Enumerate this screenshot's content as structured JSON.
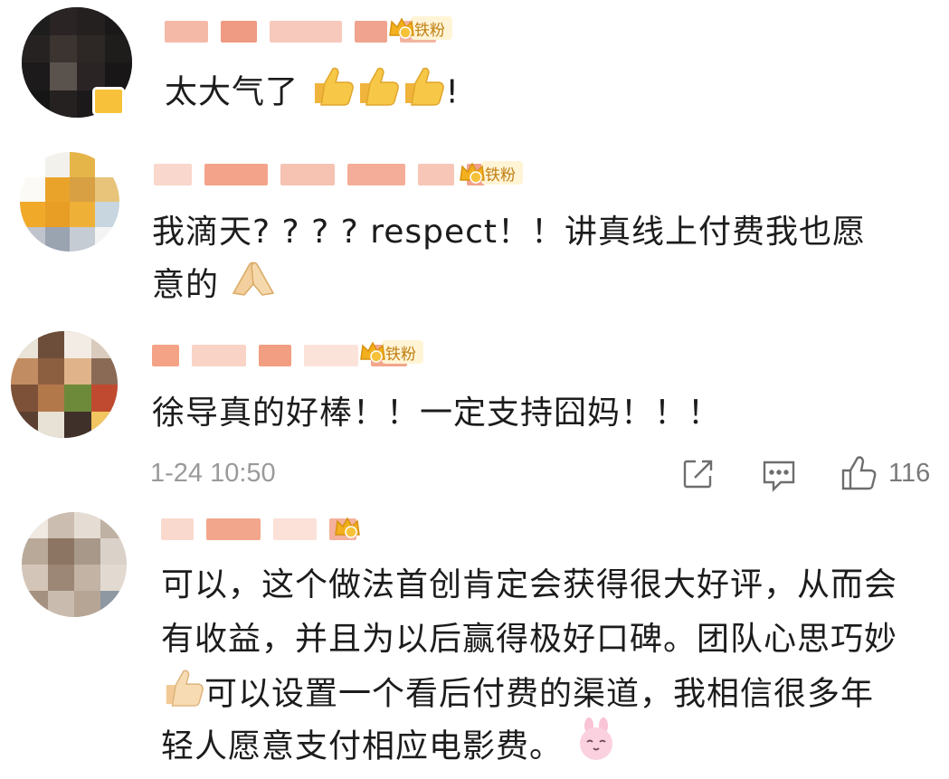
{
  "comments": [
    {
      "name_hidden": true,
      "fan_level": "4",
      "fan_label": "铁粉",
      "text": "太大气了",
      "text_suffix": "!",
      "emoji": [
        "thumbs-up",
        "thumbs-up",
        "thumbs-up"
      ]
    },
    {
      "name_hidden": true,
      "fan_level": "6",
      "fan_label": "铁粉",
      "line1": "我滴天? ? ? ? respect！！讲真线上付费我也愿",
      "line2": "意的",
      "emoji": [
        "pray"
      ]
    },
    {
      "name_hidden": true,
      "fan_level": "4",
      "fan_label": "铁粉",
      "text": "徐导真的好棒！！一定支持囧妈！！！",
      "timestamp": "1-24 10:50",
      "like_count": "116"
    },
    {
      "name_hidden": true,
      "fan_level": "5",
      "line1": "可以，这个做法首创肯定会获得很大好评，从而会",
      "line2": "有收益，并且为以后赢得极好口碑。团队心思巧妙",
      "line3": "可以设置一个看后付费的渠道，我相信很多年",
      "line4": "轻人愿意支付相应电影费。",
      "emoji": [
        "thumbs-up",
        "bunny-face"
      ]
    }
  ],
  "colors": {
    "fan_text": "#c17f12",
    "fan_bg": "#fff4d6",
    "crown": "#f2b01e",
    "meta": "#9a9a9a"
  }
}
